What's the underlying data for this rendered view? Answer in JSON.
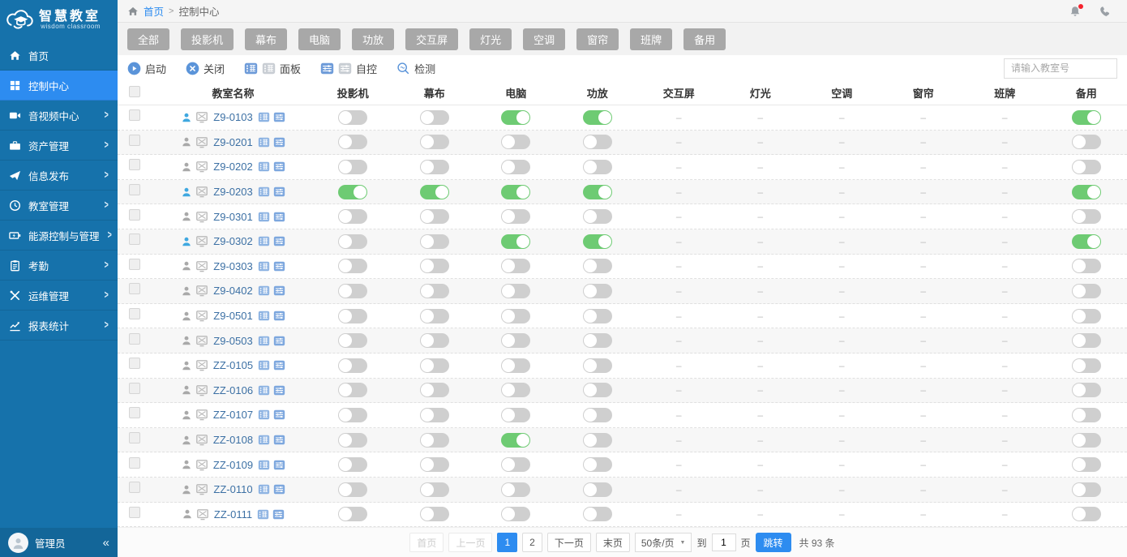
{
  "app": {
    "title": "智慧教室",
    "subtitle": "wisdom classroom"
  },
  "colors": {
    "accent": "#2d8cf0",
    "sidebar": "#1672ab",
    "toggle_on": "#6ecb73",
    "toggle_off": "#cfcfcf",
    "badge": "#f5222d"
  },
  "topbar": {
    "home": "首页",
    "separator": ">",
    "current": "控制中心"
  },
  "sidebar": {
    "arrow_glyph": ">",
    "items": [
      {
        "label": "首页",
        "icon": "home",
        "active": false,
        "has_submenu": false
      },
      {
        "label": "控制中心",
        "icon": "control",
        "active": true,
        "has_submenu": false
      },
      {
        "label": "音视频中心",
        "icon": "video",
        "active": false,
        "has_submenu": true
      },
      {
        "label": "资产管理",
        "icon": "briefcase",
        "active": false,
        "has_submenu": true
      },
      {
        "label": "信息发布",
        "icon": "send",
        "active": false,
        "has_submenu": true
      },
      {
        "label": "教室管理",
        "icon": "clock",
        "active": false,
        "has_submenu": true
      },
      {
        "label": "能源控制与管理",
        "icon": "energy",
        "active": false,
        "has_submenu": true
      },
      {
        "label": "考勤",
        "icon": "clipboard",
        "active": false,
        "has_submenu": true
      },
      {
        "label": "运维管理",
        "icon": "tools",
        "active": false,
        "has_submenu": true
      },
      {
        "label": "报表统计",
        "icon": "chart",
        "active": false,
        "has_submenu": true
      }
    ],
    "user": {
      "name": "管理员",
      "collapse_glyph": "«"
    }
  },
  "filters": [
    "全部",
    "投影机",
    "幕布",
    "电脑",
    "功放",
    "交互屏",
    "灯光",
    "空调",
    "窗帘",
    "班牌",
    "备用"
  ],
  "toolbar": {
    "start": "启动",
    "close": "关闭",
    "panel": "面板",
    "auto_control": "自控",
    "detect": "检测",
    "search_placeholder": "请输入教室号"
  },
  "table": {
    "dash": "–",
    "headers": [
      "教室名称",
      "投影机",
      "幕布",
      "电脑",
      "功放",
      "交互屏",
      "灯光",
      "空调",
      "窗帘",
      "班牌",
      "备用"
    ],
    "rows": [
      {
        "name": "Z9-0103",
        "online": true,
        "projector": "off",
        "screen": "off",
        "computer": "on",
        "amplifier": "on",
        "spare": "on"
      },
      {
        "name": "Z9-0201",
        "online": false,
        "projector": "off",
        "screen": "off",
        "computer": "off",
        "amplifier": "off",
        "spare": "off"
      },
      {
        "name": "Z9-0202",
        "online": false,
        "projector": "off",
        "screen": "off",
        "computer": "off",
        "amplifier": "off",
        "spare": "off"
      },
      {
        "name": "Z9-0203",
        "online": true,
        "projector": "on",
        "screen": "on",
        "computer": "on",
        "amplifier": "on",
        "spare": "on"
      },
      {
        "name": "Z9-0301",
        "online": false,
        "projector": "off",
        "screen": "off",
        "computer": "off",
        "amplifier": "off",
        "spare": "off"
      },
      {
        "name": "Z9-0302",
        "online": true,
        "projector": "off",
        "screen": "off",
        "computer": "on",
        "amplifier": "on",
        "spare": "on"
      },
      {
        "name": "Z9-0303",
        "online": false,
        "projector": "off",
        "screen": "off",
        "computer": "off",
        "amplifier": "off",
        "spare": "off"
      },
      {
        "name": "Z9-0402",
        "online": false,
        "projector": "off",
        "screen": "off",
        "computer": "off",
        "amplifier": "off",
        "spare": "off"
      },
      {
        "name": "Z9-0501",
        "online": false,
        "projector": "off",
        "screen": "off",
        "computer": "off",
        "amplifier": "off",
        "spare": "off"
      },
      {
        "name": "Z9-0503",
        "online": false,
        "projector": "off",
        "screen": "off",
        "computer": "off",
        "amplifier": "off",
        "spare": "off"
      },
      {
        "name": "ZZ-0105",
        "online": false,
        "projector": "off",
        "screen": "off",
        "computer": "off",
        "amplifier": "off",
        "spare": "off"
      },
      {
        "name": "ZZ-0106",
        "online": false,
        "projector": "off",
        "screen": "off",
        "computer": "off",
        "amplifier": "off",
        "spare": "off"
      },
      {
        "name": "ZZ-0107",
        "online": false,
        "projector": "off",
        "screen": "off",
        "computer": "off",
        "amplifier": "off",
        "spare": "off"
      },
      {
        "name": "ZZ-0108",
        "online": false,
        "projector": "off",
        "screen": "off",
        "computer": "on",
        "amplifier": "off",
        "spare": "off"
      },
      {
        "name": "ZZ-0109",
        "online": false,
        "projector": "off",
        "screen": "off",
        "computer": "off",
        "amplifier": "off",
        "spare": "off"
      },
      {
        "name": "ZZ-0110",
        "online": false,
        "projector": "off",
        "screen": "off",
        "computer": "off",
        "amplifier": "off",
        "spare": "off"
      },
      {
        "name": "ZZ-0111",
        "online": false,
        "projector": "off",
        "screen": "off",
        "computer": "off",
        "amplifier": "off",
        "spare": "off"
      }
    ]
  },
  "pagination": {
    "first": "首页",
    "prev": "上一页",
    "pages": [
      "1",
      "2"
    ],
    "active_page": "1",
    "next": "下一页",
    "last": "末页",
    "page_size": "50条/页",
    "caret": "▼",
    "to_label": "到",
    "jump_value": "1",
    "page_unit": "页",
    "jump_button": "跳转",
    "total": "共 93 条"
  }
}
